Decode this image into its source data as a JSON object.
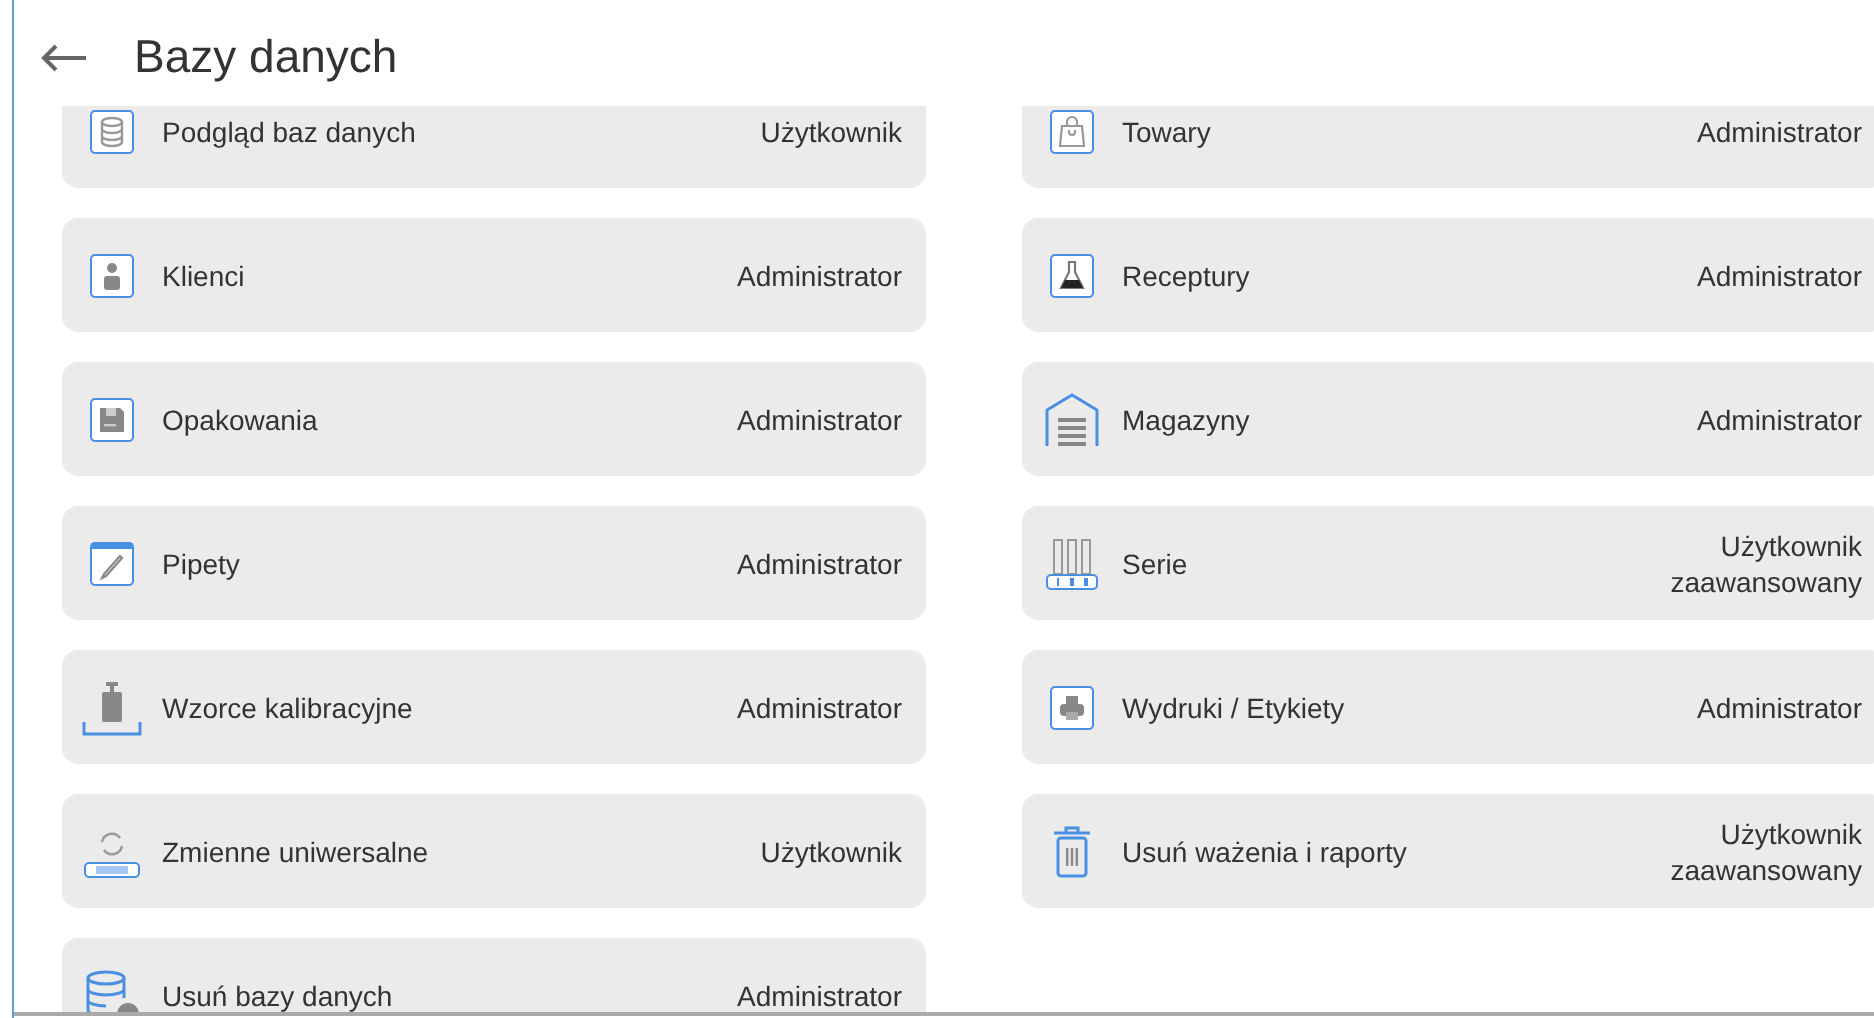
{
  "header": {
    "title": "Bazy danych"
  },
  "rows": [
    {
      "items": [
        {
          "label": "Podgląd baz danych",
          "access": "Użytkownik"
        },
        {
          "label": "Towary",
          "access": "Administrator"
        }
      ]
    },
    {
      "items": [
        {
          "label": "Klienci",
          "access": "Administrator"
        },
        {
          "label": "Receptury",
          "access": "Administrator"
        }
      ]
    },
    {
      "items": [
        {
          "label": "Opakowania",
          "access": "Administrator"
        },
        {
          "label": "Magazyny",
          "access": "Administrator"
        }
      ]
    },
    {
      "items": [
        {
          "label": "Pipety",
          "access": "Administrator"
        },
        {
          "label": "Serie",
          "access": "Użytkownik zaawansowany"
        }
      ]
    },
    {
      "items": [
        {
          "label": "Wzorce kalibracyjne",
          "access": "Administrator"
        },
        {
          "label": "Wydruki / Etykiety",
          "access": "Administrator"
        }
      ]
    },
    {
      "items": [
        {
          "label": "Zmienne uniwersalne",
          "access": "Użytkownik"
        },
        {
          "label": "Usuń ważenia i raporty",
          "access": "Użytkownik zaawansowany"
        }
      ]
    },
    {
      "items": [
        {
          "label": "Usuń bazy danych",
          "access": "Administrator"
        }
      ]
    }
  ]
}
